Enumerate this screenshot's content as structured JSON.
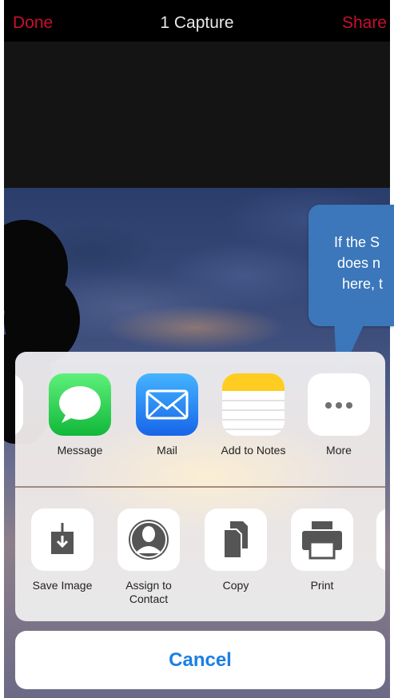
{
  "navbar": {
    "done_label": "Done",
    "title": "1 Capture",
    "share_label": "Share"
  },
  "callout": {
    "lines": [
      "If the S",
      "does n",
      "here, t"
    ]
  },
  "share_apps": [
    {
      "label": "Message",
      "icon": "message-icon"
    },
    {
      "label": "Mail",
      "icon": "mail-icon"
    },
    {
      "label": "Add to Notes",
      "icon": "notes-icon"
    },
    {
      "label": "More",
      "icon": "more-icon"
    }
  ],
  "actions": [
    {
      "label": "Save Image",
      "icon": "save-image-icon"
    },
    {
      "label": "Assign to Contact",
      "icon": "contact-icon"
    },
    {
      "label": "Copy",
      "icon": "copy-icon"
    },
    {
      "label": "Print",
      "icon": "print-icon"
    }
  ],
  "cancel_label": "Cancel",
  "colors": {
    "accent_red": "#c8102e",
    "ios_blue": "#1a7fe6",
    "callout_blue": "#3b77ba"
  }
}
